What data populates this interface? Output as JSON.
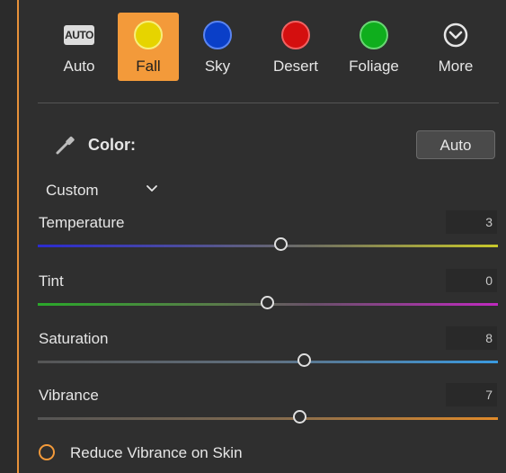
{
  "presets": [
    {
      "label": "Auto",
      "icon": "auto-icon",
      "active": false
    },
    {
      "label": "Fall",
      "icon": "yellow-circle",
      "color": "#e6d400",
      "active": true
    },
    {
      "label": "Sky",
      "icon": "blue-circle",
      "color": "#0a3fc8",
      "active": false
    },
    {
      "label": "Desert",
      "icon": "red-circle",
      "color": "#d40f0f",
      "active": false
    },
    {
      "label": "Foliage",
      "icon": "green-circle",
      "color": "#0fae1d",
      "active": false
    },
    {
      "label": "More",
      "icon": "chevron-down-circle-icon",
      "active": false
    }
  ],
  "auto_icon_text": "AUTO",
  "color_section": {
    "title": "Color:",
    "auto_button": "Auto",
    "mode": "Custom"
  },
  "sliders": [
    {
      "label": "Temperature",
      "value": "3",
      "fraction": 0.53
    },
    {
      "label": "Tint",
      "value": "0",
      "fraction": 0.5
    },
    {
      "label": "Saturation",
      "value": "8",
      "fraction": 0.58
    },
    {
      "label": "Vibrance",
      "value": "7",
      "fraction": 0.57
    }
  ],
  "reduce_vibrance": "Reduce Vibrance on Skin",
  "accent_color": "#f39a3a"
}
